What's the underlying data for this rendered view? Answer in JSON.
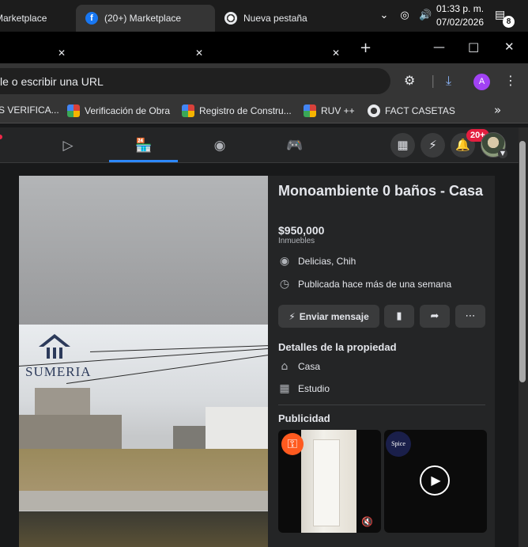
{
  "taskbar": {
    "time": "01:33 p. m.",
    "date": "07/02/2026",
    "notification_count": "8"
  },
  "tabs": [
    {
      "title": "Marketplace",
      "favicon": "facebook"
    },
    {
      "title": "(20+) Marketplace",
      "favicon": "facebook"
    },
    {
      "title": "Nueva pestaña",
      "favicon": "chrome"
    }
  ],
  "omnibox": {
    "text": "le o escribir una URL"
  },
  "profile_initial": "A",
  "bookmarks": [
    {
      "label": "S VERIFICA...",
      "color": "#6b7aa8"
    },
    {
      "label": "Verificación de Obra",
      "color": "#d8413b"
    },
    {
      "label": "Registro de Constru...",
      "color": "#d8413b"
    },
    {
      "label": "RUV ++",
      "color": "#d8413b"
    },
    {
      "label": "FACT CASETAS",
      "color": "#e8eaed"
    }
  ],
  "fb_nav": {
    "notifications_badge": "20+"
  },
  "listing": {
    "title": "Monoambiente 0 baños - Casa",
    "price": "$950,000",
    "category": "Inmuebles",
    "location": "Delicias, Chih",
    "published": "Publicada hace más de una semana",
    "message_button": "Enviar mensaje",
    "details_heading": "Detalles de la propiedad",
    "details": [
      "Casa",
      "Estudio"
    ],
    "ads_heading": "Publicidad",
    "photo_logo_text": "SUMERIA",
    "ad2_logo_text": "Spice"
  }
}
